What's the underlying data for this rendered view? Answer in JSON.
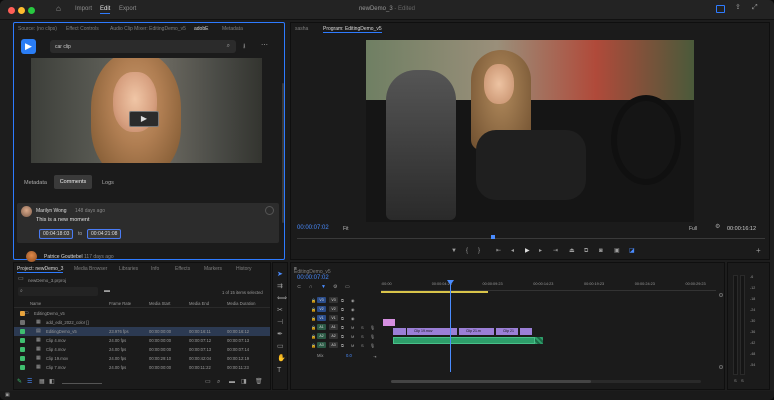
{
  "menu": {
    "import": "Import",
    "edit": "Edit",
    "export": "Export"
  },
  "window_title": "newDemo_3",
  "window_status": "- Edited",
  "source_tabs": [
    "Source: (no clips)",
    "Effect Controls",
    "Audio Clip Mixer: EditingDemo_v5",
    "adobE",
    "Metadata"
  ],
  "search": {
    "query": "car clip"
  },
  "comments_tabs": [
    "Metadata",
    "Comments",
    "Logs"
  ],
  "comment1": {
    "author": "Marilyn Wong",
    "time": "148 days ago",
    "text": "This is a new moment",
    "tc_in": "00:04:18:03",
    "to": "to",
    "tc_out": "00:04:21:08"
  },
  "comment2": {
    "author": "Patrice Gouttebel",
    "time": "117 days ago"
  },
  "program_tabs": [
    "sasha",
    "Program: EditingDemo_v5"
  ],
  "program": {
    "timecode": "00:00:07:02",
    "fit": "Fit",
    "full": "Full",
    "duration": "00:00:16:12"
  },
  "project_tabs": [
    "Project: newDemo_3",
    "Media Browser",
    "Libraries",
    "Info",
    "Effects",
    "Markers",
    "History"
  ],
  "project": {
    "name": "newDemo_3.prproj",
    "selected": "1 of 15 items selected"
  },
  "columns": [
    "Name",
    "Frame Rate",
    "Media Start",
    "Media End",
    "Media Duration"
  ],
  "rows": [
    {
      "name": "EditingDemo_v5",
      "rate": "",
      "start": "",
      "end": "",
      "dur": "",
      "color": "#e8a33b",
      "kind": "bin"
    },
    {
      "name": "add_edit_2022_color []",
      "rate": "",
      "start": "",
      "end": "",
      "dur": "",
      "color": "#6f6f6f",
      "kind": "file"
    },
    {
      "name": "EditingDemo_v5",
      "rate": "23.976 fps",
      "start": "00:00:00:00",
      "end": "00:00:16:11",
      "dur": "00:00:16:12",
      "color": "#3fbf6f",
      "kind": "seq"
    },
    {
      "name": "Clip 4.mov",
      "rate": "24.00 fps",
      "start": "00:00:00:00",
      "end": "00:00:07:12",
      "dur": "00:00:07:13",
      "color": "#3fbf6f",
      "kind": "clip"
    },
    {
      "name": "Clip 4.mov",
      "rate": "24.00 fps",
      "start": "00:00:00:00",
      "end": "00:00:07:13",
      "dur": "00:00:07:14",
      "color": "#3fbf6f",
      "kind": "clip"
    },
    {
      "name": "Clip 19.mov",
      "rate": "24.00 fps",
      "start": "00:00:29:10",
      "end": "00:00:42:04",
      "dur": "00:00:12:19",
      "color": "#3fbf6f",
      "kind": "clip"
    },
    {
      "name": "Clip 7.mov",
      "rate": "24.00 fps",
      "start": "00:00:00:00",
      "end": "00:00:11:22",
      "dur": "00:00:11:23",
      "color": "#3fbf6f",
      "kind": "clip"
    }
  ],
  "timeline": {
    "tab": "EditingDemo_v5",
    "timecode": "00:00:07:02",
    "ruler": [
      ":00:00",
      "00:00:04:23",
      "00:00:09:23",
      "00:00:14:23",
      "00:00:19:23",
      "00:00:24:23",
      "00:00:29:23"
    ],
    "video_tracks": [
      "V3",
      "V2",
      "V1"
    ],
    "audio_tracks": [
      "A1",
      "A2",
      "A3"
    ],
    "mix_label": "Mix",
    "mix_value": "0.0",
    "clips_v1": [
      "Clip 19.mov",
      "Clip 21.m",
      "Clip 21"
    ],
    "meter_labels": [
      "-6",
      "-12",
      "-18",
      "-24",
      "-30",
      "-36",
      "-42",
      "-48",
      "-54"
    ],
    "meter_bottom": [
      "S",
      "S"
    ]
  },
  "colors": {
    "accent": "#2e7bff",
    "video_clip": "#9b7fd6",
    "audio_clip": "#2e9e6a",
    "playhead": "#4a8cff",
    "pink_clip": "#d58fe0"
  }
}
